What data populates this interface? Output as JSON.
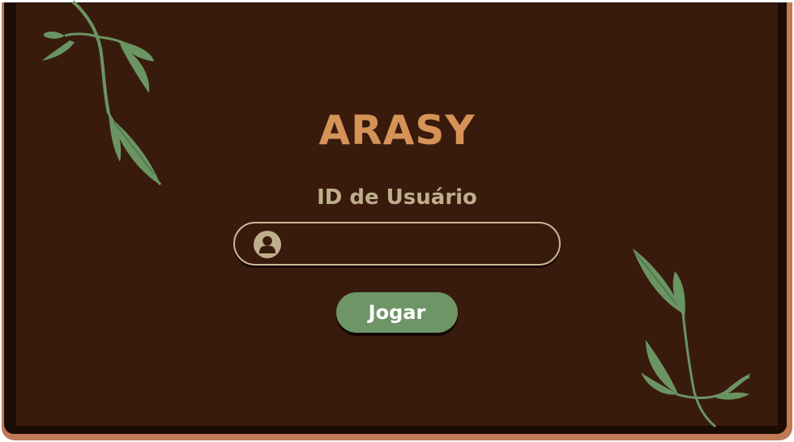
{
  "app": {
    "title": "ARASY"
  },
  "login": {
    "id_label": "ID de Usuário",
    "id_value": "",
    "id_placeholder": "",
    "user_icon": "user-icon",
    "play_button_label": "Jogar"
  },
  "decorations": {
    "top_left": "leaf-branch-icon",
    "bottom_right": "leaf-branch-icon"
  },
  "colors": {
    "panel_background": "#391b0d",
    "frame_border": "#c07a55",
    "title": "#d69357",
    "label": "#bfae8c",
    "input_border": "#cbb994",
    "button": "#6e9566",
    "leaf": "#6a9563"
  }
}
